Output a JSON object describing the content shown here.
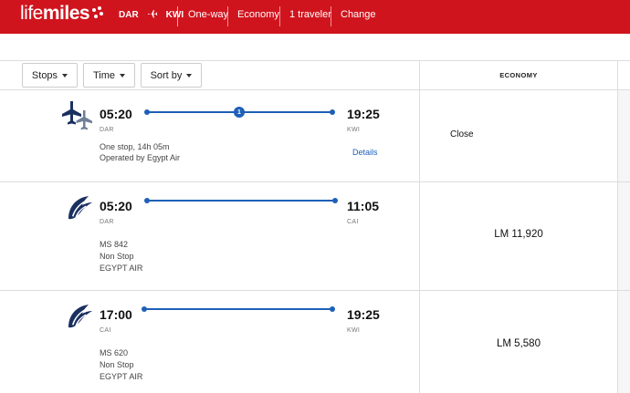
{
  "header": {
    "logo_part1": "life",
    "logo_part2": "miles",
    "origin": "DAR",
    "destination": "KWI",
    "trip_type": "One-way",
    "cabin": "Economy",
    "travelers": "1 traveler",
    "change": "Change",
    "bg_color": "#d0141e"
  },
  "filters": {
    "stops": "Stops",
    "time": "Time",
    "sort": "Sort by"
  },
  "fare_header": "ECONOMY",
  "accent_color": "#1e5fb8",
  "flights": [
    {
      "depart_time": "05:20",
      "depart_code": "DAR",
      "arrive_time": "19:25",
      "arrive_code": "KWI",
      "stops_badge": "1",
      "line1": "One stop, 14h 05m",
      "line2": "Operated by Egypt Air",
      "details": "Details",
      "fare": "Close",
      "icon": "multi-plane-icon"
    },
    {
      "depart_time": "05:20",
      "depart_code": "DAR",
      "arrive_time": "11:05",
      "arrive_code": "CAI",
      "line1": "MS 842",
      "line2": "Non Stop",
      "line3": "EGYPT AIR",
      "fare": "LM 11,920",
      "icon": "egyptair-logo-icon"
    },
    {
      "depart_time": "17:00",
      "depart_code": "CAI",
      "arrive_time": "19:25",
      "arrive_code": "KWI",
      "line1": "MS 620",
      "line2": "Non Stop",
      "line3": "EGYPT AIR",
      "fare": "LM 5,580",
      "icon": "egyptair-logo-icon"
    }
  ]
}
